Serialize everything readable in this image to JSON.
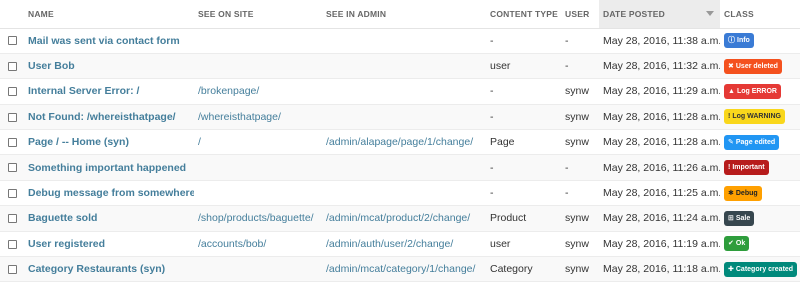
{
  "headers": {
    "name": "NAME",
    "see_on_site": "SEE ON SITE",
    "see_in_admin": "SEE IN ADMIN",
    "content_type": "CONTENT TYPE",
    "user": "USER",
    "date_posted": "DATE POSTED",
    "class": "CLASS"
  },
  "rows": [
    {
      "name": "Mail was sent via contact form",
      "site": "",
      "admin": "",
      "ctype": "-",
      "user": "-",
      "date": "May 28, 2016, 11:38 a.m.",
      "badge": {
        "label": "Info",
        "icon": "info-icon",
        "glyph": "ⓘ",
        "color": "#3a7bd5"
      }
    },
    {
      "name": "User Bob",
      "site": "",
      "admin": "",
      "ctype": "user",
      "user": "-",
      "date": "May 28, 2016, 11:32 a.m.",
      "badge": {
        "label": "User deleted",
        "icon": "x-icon",
        "glyph": "✖",
        "color": "#f4511e"
      }
    },
    {
      "name": "Internal Server Error: /",
      "site": "/brokenpage/",
      "admin": "",
      "ctype": "-",
      "user": "synw",
      "date": "May 28, 2016, 11:29 a.m.",
      "badge": {
        "label": "Log ERROR",
        "icon": "warning-icon",
        "glyph": "▲",
        "color": "#e53935"
      }
    },
    {
      "name": "Not Found: /whereisthatpage/",
      "site": "/whereisthatpage/",
      "admin": "",
      "ctype": "-",
      "user": "synw",
      "date": "May 28, 2016, 11:28 a.m.",
      "badge": {
        "label": "Log WARNING",
        "icon": "exclamation-icon",
        "glyph": "!",
        "color": "#f9d71c",
        "text": "#333"
      }
    },
    {
      "name": "Page / -- Home (syn)",
      "site": "/",
      "admin": "/admin/alapage/page/1/change/",
      "ctype": "Page",
      "user": "synw",
      "date": "May 28, 2016, 11:28 a.m.",
      "badge": {
        "label": "Page edited",
        "icon": "pencil-icon",
        "glyph": "✎",
        "color": "#2196f3"
      }
    },
    {
      "name": "Something important happened",
      "site": "",
      "admin": "",
      "ctype": "-",
      "user": "-",
      "date": "May 28, 2016, 11:26 a.m.",
      "badge": {
        "label": "Important",
        "icon": "exclamation-icon",
        "glyph": "!",
        "color": "#b71c1c"
      }
    },
    {
      "name": "Debug message from somewhere",
      "site": "",
      "admin": "",
      "ctype": "-",
      "user": "-",
      "date": "May 28, 2016, 11:25 a.m.",
      "badge": {
        "label": "Debug",
        "icon": "gear-icon",
        "glyph": "✱",
        "color": "#ffa000",
        "text": "#222"
      }
    },
    {
      "name": "Baguette sold",
      "site": "/shop/products/baguette/",
      "admin": "/admin/mcat/product/2/change/",
      "ctype": "Product",
      "user": "synw",
      "date": "May 28, 2016, 11:24 a.m.",
      "badge": {
        "label": "Sale",
        "icon": "cart-icon",
        "glyph": "⊞",
        "color": "#37474f"
      }
    },
    {
      "name": "User registered",
      "site": "/accounts/bob/",
      "admin": "/admin/auth/user/2/change/",
      "ctype": "user",
      "user": "synw",
      "date": "May 28, 2016, 11:19 a.m.",
      "badge": {
        "label": "Ok",
        "icon": "thumbs-up-icon",
        "glyph": "✔",
        "color": "#2e9d3c"
      }
    },
    {
      "name": "Category Restaurants (syn)",
      "site": "",
      "admin": "/admin/mcat/category/1/change/",
      "ctype": "Category",
      "user": "synw",
      "date": "May 28, 2016, 11:18 a.m.",
      "badge": {
        "label": "Category created",
        "icon": "plus-icon",
        "glyph": "✚",
        "color": "#00897b"
      }
    }
  ]
}
